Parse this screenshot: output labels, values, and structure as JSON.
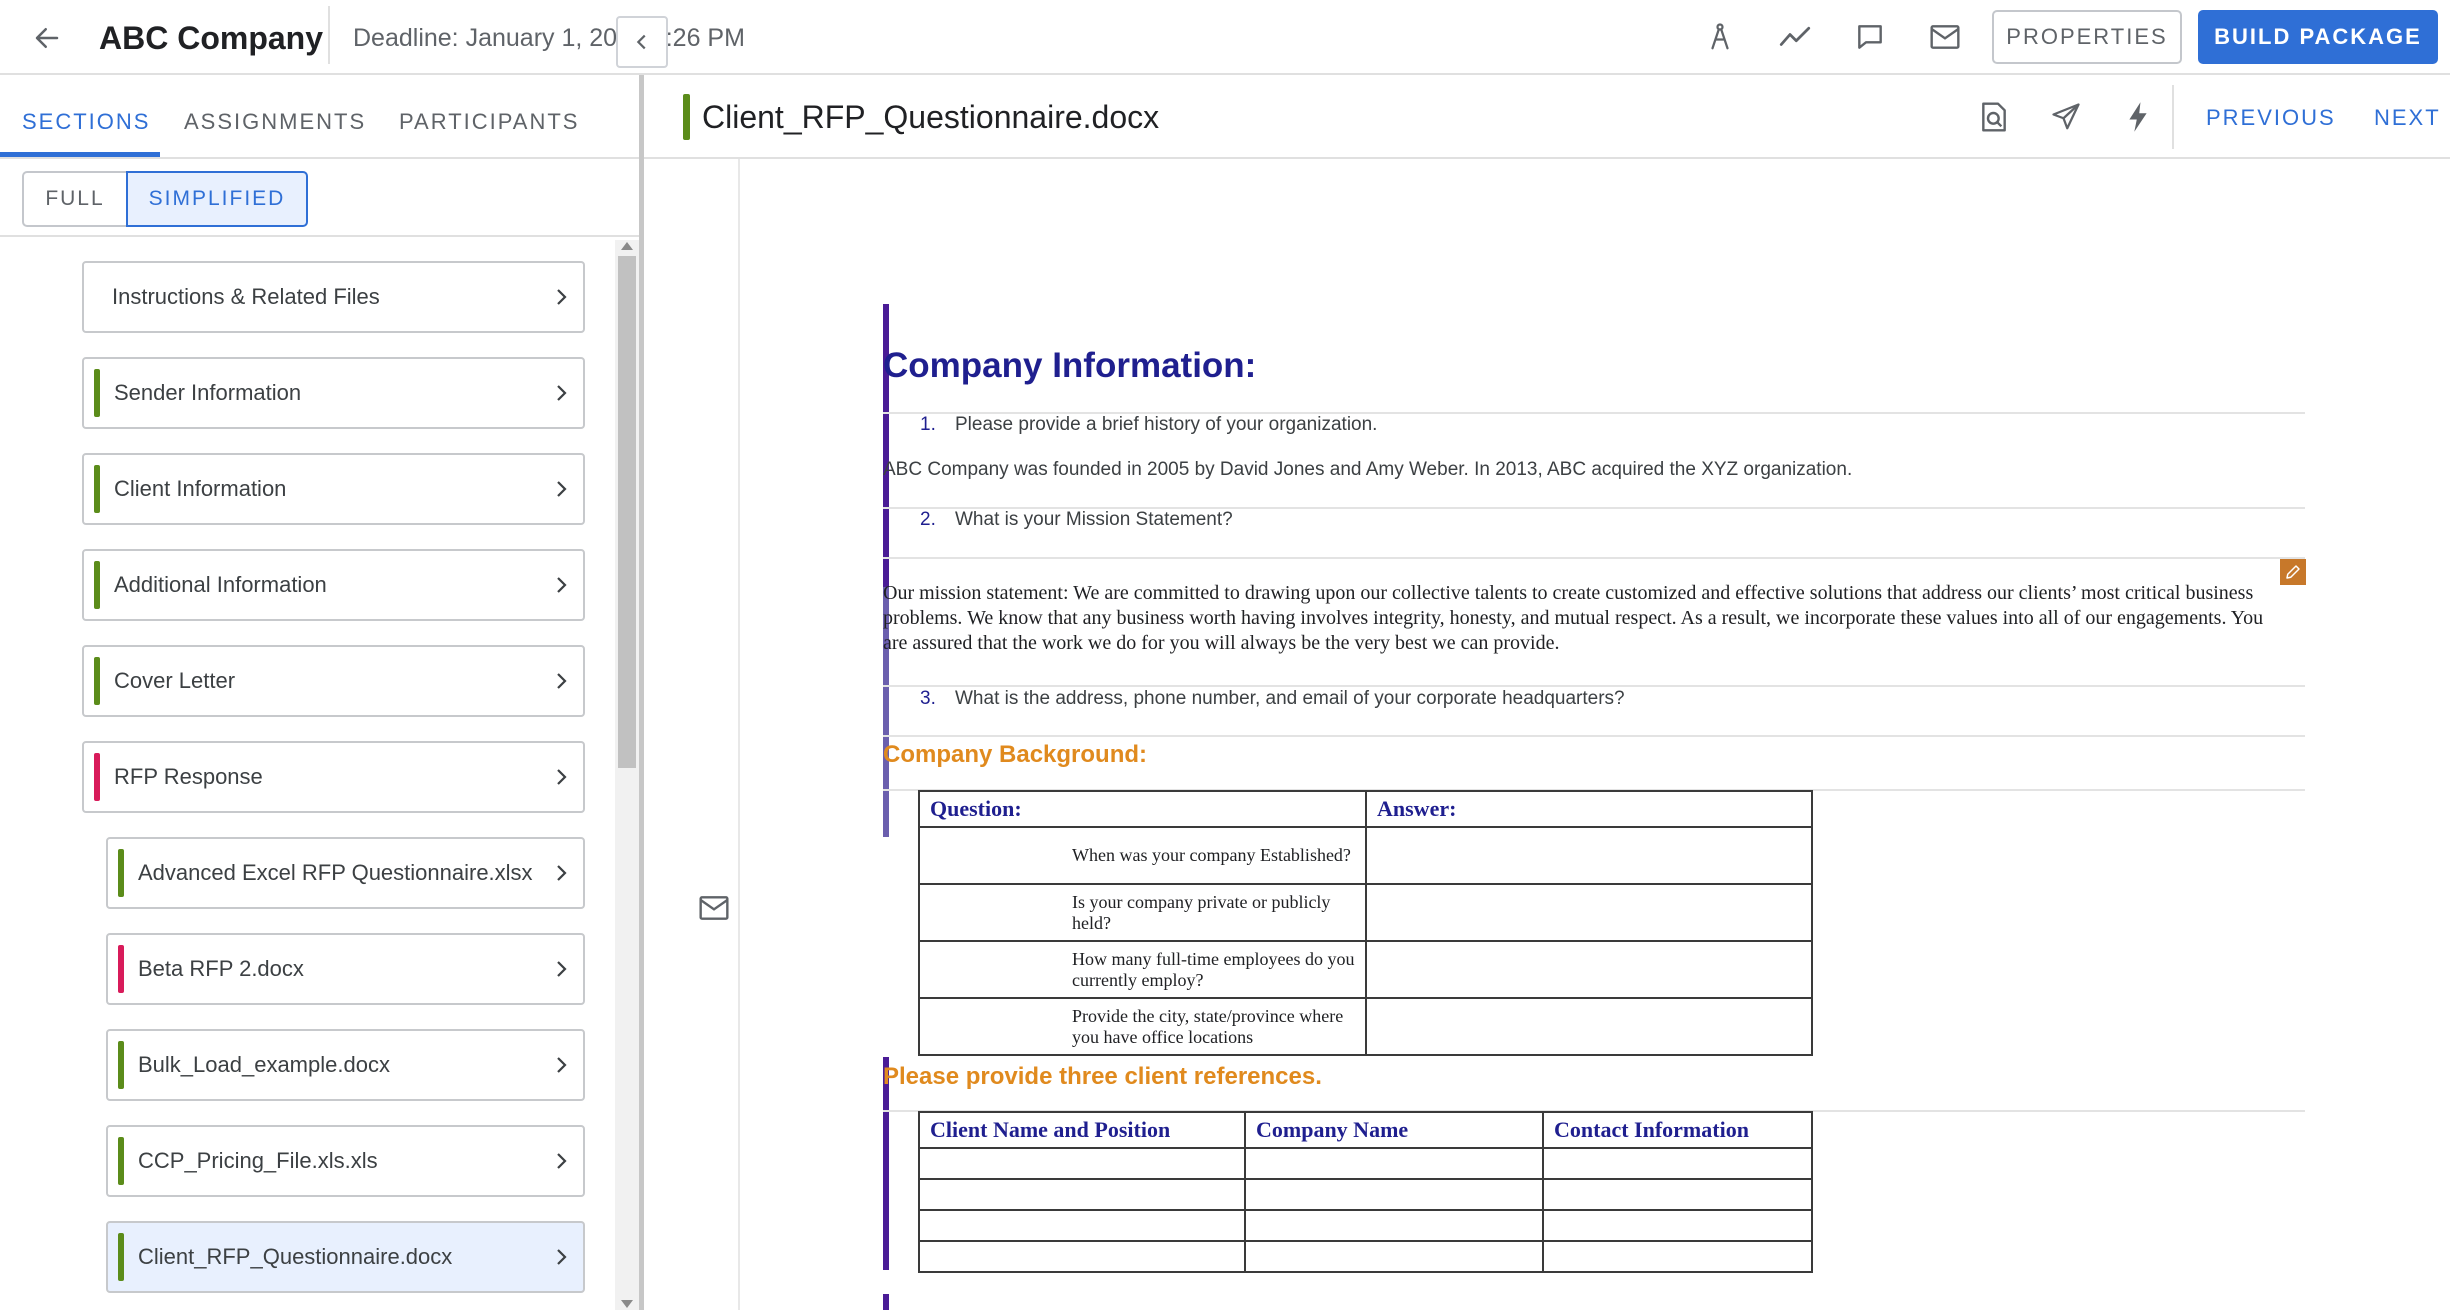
{
  "header": {
    "company": "ABC Company",
    "deadline": "Deadline: January 1, 2026 2:26 PM",
    "properties_label": "PROPERTIES",
    "build_label": "BUILD PACKAGE"
  },
  "left_panel": {
    "tabs": [
      {
        "label": "SECTIONS",
        "active": true
      },
      {
        "label": "ASSIGNMENTS",
        "active": false
      },
      {
        "label": "PARTICIPANTS",
        "active": false
      }
    ],
    "view_toggle": {
      "full": "FULL",
      "simplified": "SIMPLIFIED",
      "selected": "SIMPLIFIED"
    },
    "items": [
      {
        "label": "Instructions & Related Files",
        "status_color": ""
      },
      {
        "label": "Sender Information",
        "status_color": "#5b8c1a"
      },
      {
        "label": "Client Information",
        "status_color": "#5b8c1a"
      },
      {
        "label": "Additional Information",
        "status_color": "#5b8c1a"
      },
      {
        "label": "Cover Letter",
        "status_color": "#5b8c1a"
      },
      {
        "label": "RFP Response",
        "status_color": "#d81b5a"
      },
      {
        "label": "Advanced Excel RFP Questionnaire.xlsx",
        "status_color": "#5b8c1a"
      },
      {
        "label": "Beta RFP 2.docx",
        "status_color": "#d81b5a"
      },
      {
        "label": "Bulk_Load_example.docx",
        "status_color": "#5b8c1a"
      },
      {
        "label": "CCP_Pricing_File.xls.xls",
        "status_color": "#5b8c1a"
      },
      {
        "label": "Client_RFP_Questionnaire.docx",
        "status_color": "#5b8c1a",
        "selected": true
      }
    ]
  },
  "doc_header": {
    "title": "Client_RFP_Questionnaire.docx",
    "previous_label": "PREVIOUS",
    "next_label": "NEXT"
  },
  "document": {
    "heading": "Company Information:",
    "questions": [
      {
        "num": "1.",
        "text": "Please provide a brief history of your organization."
      },
      {
        "num": "2.",
        "text": "What is your Mission Statement?"
      },
      {
        "num": "3.",
        "text": "What is the address, phone number, and email of your corporate headquarters?"
      }
    ],
    "answer1": "ABC Company was founded in 2005 by David Jones and Amy Weber. In 2013, ABC acquired the XYZ organization.",
    "mission": "Our mission statement: We are committed to drawing upon our collective talents to create customized and effective solutions that address our clients’ most critical business problems. We know that any business worth having involves integrity, honesty, and mutual respect. As a result, we incorporate these values into all of our engagements. You are assured that the work we do for you will always be the very best we can provide.",
    "background_heading": "Company Background:",
    "background_table": {
      "headers": [
        "Question:",
        "Answer:"
      ],
      "rows": [
        "When was your company Established?",
        "Is your company private or publicly held?",
        "How many full-time employees do you currently employ?",
        "Provide the city, state/province where you have office locations"
      ]
    },
    "references_heading": "Please provide three client references.",
    "references_table": {
      "headers": [
        "Client Name and Position",
        "Company Name",
        "Contact Information"
      ]
    }
  }
}
